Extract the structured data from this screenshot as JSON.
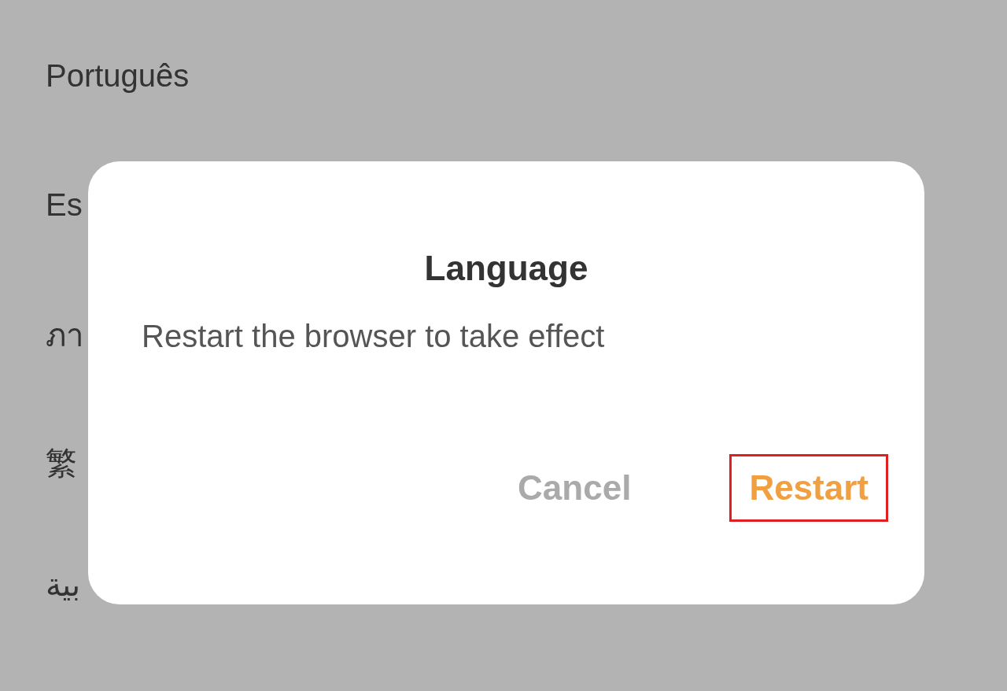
{
  "languages": [
    {
      "label": "Português"
    },
    {
      "label": "Es"
    },
    {
      "label": "ภา"
    },
    {
      "label": "繁"
    },
    {
      "label": "بية"
    }
  ],
  "dialog": {
    "title": "Language",
    "message": "Restart the browser to take effect",
    "buttons": [
      {
        "label": "Cancel",
        "kind": "secondary",
        "highlighted": false
      },
      {
        "label": "Restart",
        "kind": "primary",
        "highlighted": true
      }
    ]
  }
}
